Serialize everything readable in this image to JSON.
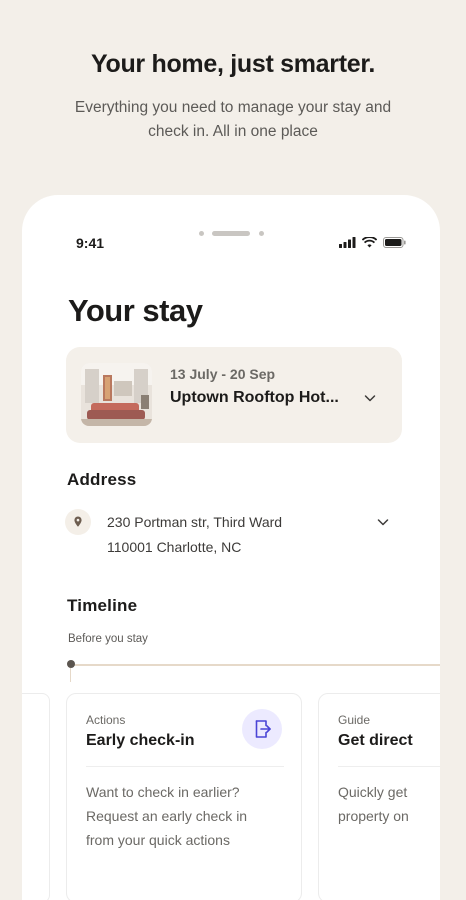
{
  "hero": {
    "title": "Your home, just smarter.",
    "subtitle_line1": "Everything you need to manage your stay and",
    "subtitle_line2": "check in. All in one place"
  },
  "status_bar": {
    "time": "9:41"
  },
  "stay": {
    "title": "Your stay",
    "dates": "13 July - 20 Sep",
    "hotel_name": "Uptown Rooftop Hot..."
  },
  "address": {
    "title": "Address",
    "line1": "230 Portman str, Third Ward",
    "line2": "110001 Charlotte, NC"
  },
  "timeline": {
    "title": "Timeline",
    "subtitle": "Before you stay",
    "cards": [
      {
        "kicker": "Actions",
        "title": "Early check-in",
        "body_line1": "Want to check in earlier?",
        "body_line2": "Request an early check in",
        "body_line3": "from your quick actions",
        "icon": "check-in-door-icon"
      },
      {
        "kicker": "Guide",
        "title": "Get direct",
        "body_line1": "Quickly get",
        "body_line2": "property on"
      }
    ]
  },
  "colors": {
    "background": "#f3efe9",
    "card_beige": "#f4f0ea",
    "accent_icon_bg": "#eceaff",
    "accent_icon": "#4a44d6",
    "timeline_line": "#e6d9c9"
  }
}
